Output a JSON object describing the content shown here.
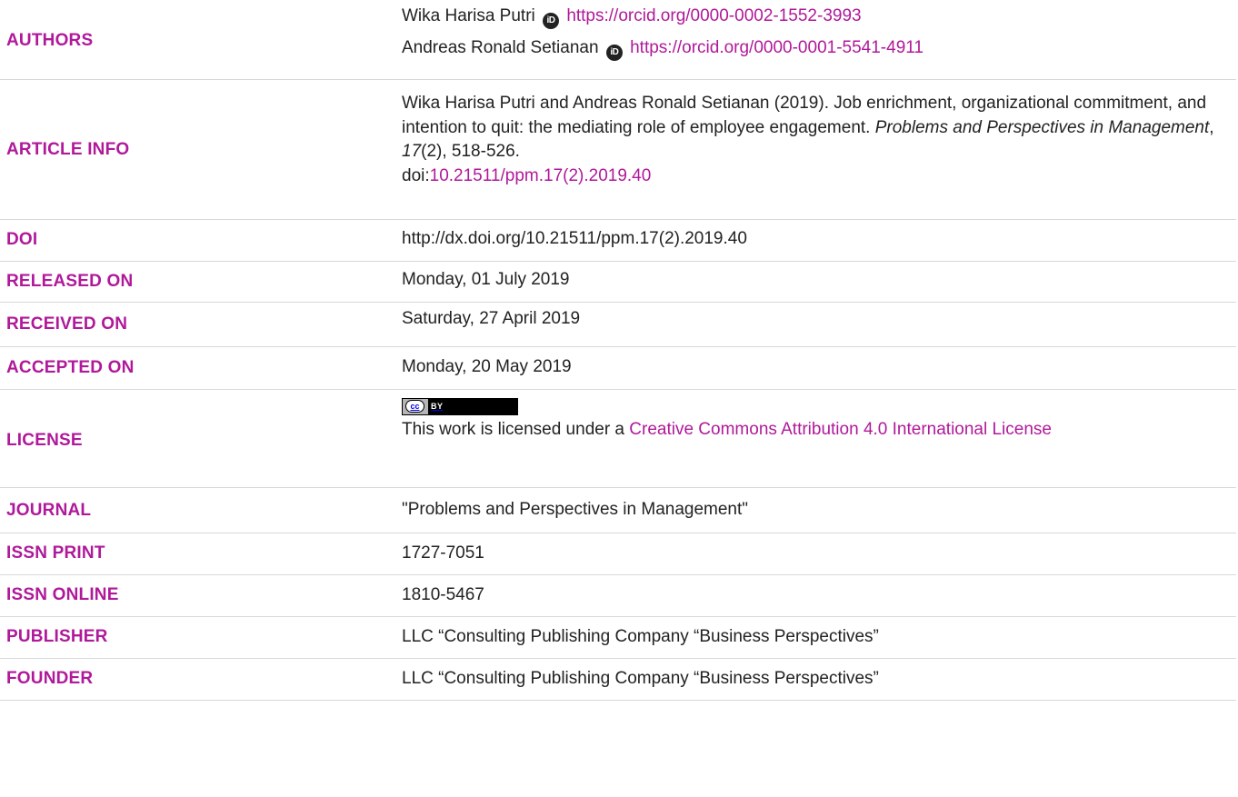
{
  "colors": {
    "label": "#b0199a",
    "link": "#b0199a",
    "rule": "#d8d8d8"
  },
  "authors": {
    "label": "AUTHORS",
    "items": [
      {
        "name": "Wika Harisa Putri",
        "orcid_icon": "orcid-icon",
        "orcid": "https://orcid.org/0000-0002-1552-3993"
      },
      {
        "name": "Andreas Ronald Setianan",
        "orcid_icon": "orcid-icon",
        "orcid": "https://orcid.org/0000-0001-5541-4911"
      }
    ]
  },
  "article_info": {
    "label": "ARTICLE INFO",
    "citation_start": "Wika Harisa Putri and Andreas Ronald Setianan (2019). Job enrichment, organizational commitment, and intention to quit: the mediating role of employee engagement. ",
    "journal_italic": "Problems and Perspectives in Management",
    "sep1": ", ",
    "volume_italic": "17",
    "issue_pages": "(2), 518-526.",
    "doi_prefix": "doi:",
    "doi_link": "10.21511/ppm.17(2).2019.40"
  },
  "doi": {
    "label": "DOI",
    "value": "http://dx.doi.org/10.21511/ppm.17(2).2019.40"
  },
  "released_on": {
    "label": "RELEASED ON",
    "value": "Monday, 01 July 2019"
  },
  "received_on": {
    "label": "RECEIVED ON",
    "value": "Saturday, 27 April 2019"
  },
  "accepted_on": {
    "label": "ACCEPTED ON",
    "value": "Monday, 20 May 2019"
  },
  "license": {
    "label": "LICENSE",
    "badge_cc": "cc",
    "badge_by": "BY",
    "text": "This work is licensed under a ",
    "link": "Creative Commons Attribution 4.0 International License"
  },
  "journal": {
    "label": "JOURNAL",
    "value": "\"Problems and Perspectives in Management\""
  },
  "issn_print": {
    "label": "ISSN PRINT",
    "value": "1727-7051"
  },
  "issn_online": {
    "label": "ISSN ONLINE",
    "value": "1810-5467"
  },
  "publisher": {
    "label": "PUBLISHER",
    "value": "LLC “Consulting Publishing Company “Business Perspectives”"
  },
  "founder": {
    "label": "FOUNDER",
    "value": "LLC “Consulting Publishing Company “Business Perspectives”"
  }
}
